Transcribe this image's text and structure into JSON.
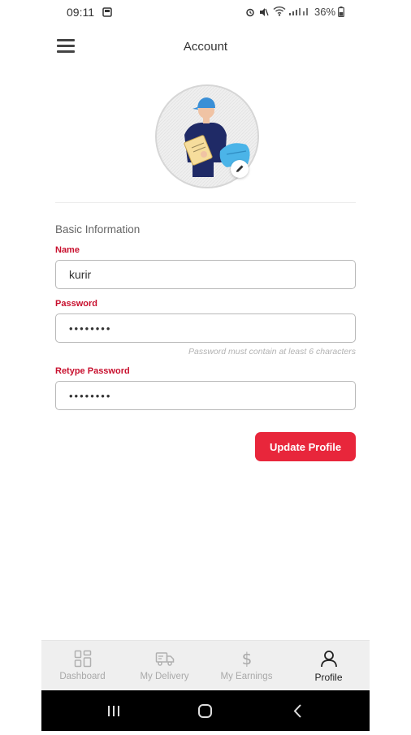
{
  "status_bar": {
    "time": "09:11",
    "battery": "36%"
  },
  "header": {
    "title": "Account"
  },
  "form": {
    "section_title": "Basic Information",
    "name": {
      "label": "Name",
      "value": "kurir"
    },
    "password": {
      "label": "Password",
      "value": "••••••••",
      "hint": "Password must contain at least 6 characters"
    },
    "retype_password": {
      "label": "Retype Password",
      "value": "••••••••"
    },
    "submit_label": "Update Profile"
  },
  "bottom_nav": {
    "items": [
      {
        "label": "Dashboard",
        "icon": "dashboard-icon",
        "active": false
      },
      {
        "label": "My Delivery",
        "icon": "truck-icon",
        "active": false
      },
      {
        "label": "My Earnings",
        "icon": "dollar-icon",
        "active": false
      },
      {
        "label": "Profile",
        "icon": "person-icon",
        "active": true
      }
    ]
  },
  "colors": {
    "accent": "#e8263b",
    "label_red": "#c8102e",
    "avatar_shirt": "#1f2a66",
    "avatar_cap": "#3a8fd6"
  }
}
